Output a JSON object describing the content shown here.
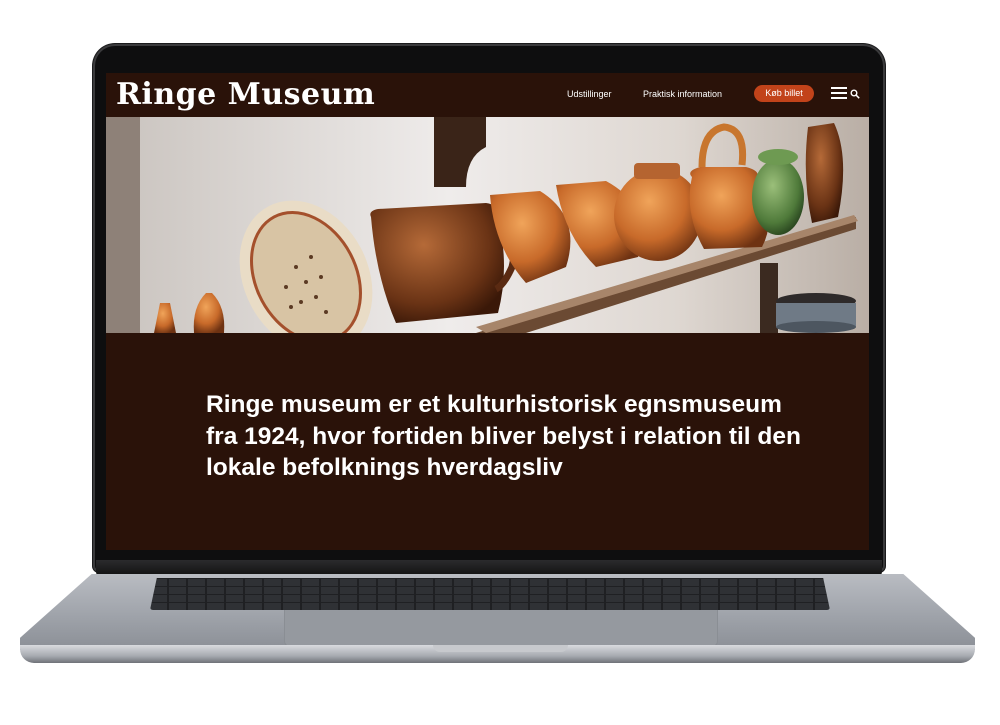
{
  "site": {
    "logo": "Ringe Museum",
    "nav": [
      {
        "label": "Udstillinger"
      },
      {
        "label": "Praktisk information"
      }
    ],
    "cta": {
      "label": "Køb billet"
    },
    "icons": {
      "menu": "hamburger-menu-icon",
      "search": "search-icon"
    },
    "colors": {
      "header_bg": "#2a1209",
      "body_bg": "#2a1209",
      "cta_bg": "#c2431a",
      "text": "#ffffff"
    }
  },
  "hero": {
    "image": "pottery-on-shelf-photo"
  },
  "main": {
    "tagline": "Ringe museum er et kulturhistorisk egnsmuseum fra 1924, hvor fortiden bliver belyst i relation til den lokale befolknings hverdagsliv"
  }
}
